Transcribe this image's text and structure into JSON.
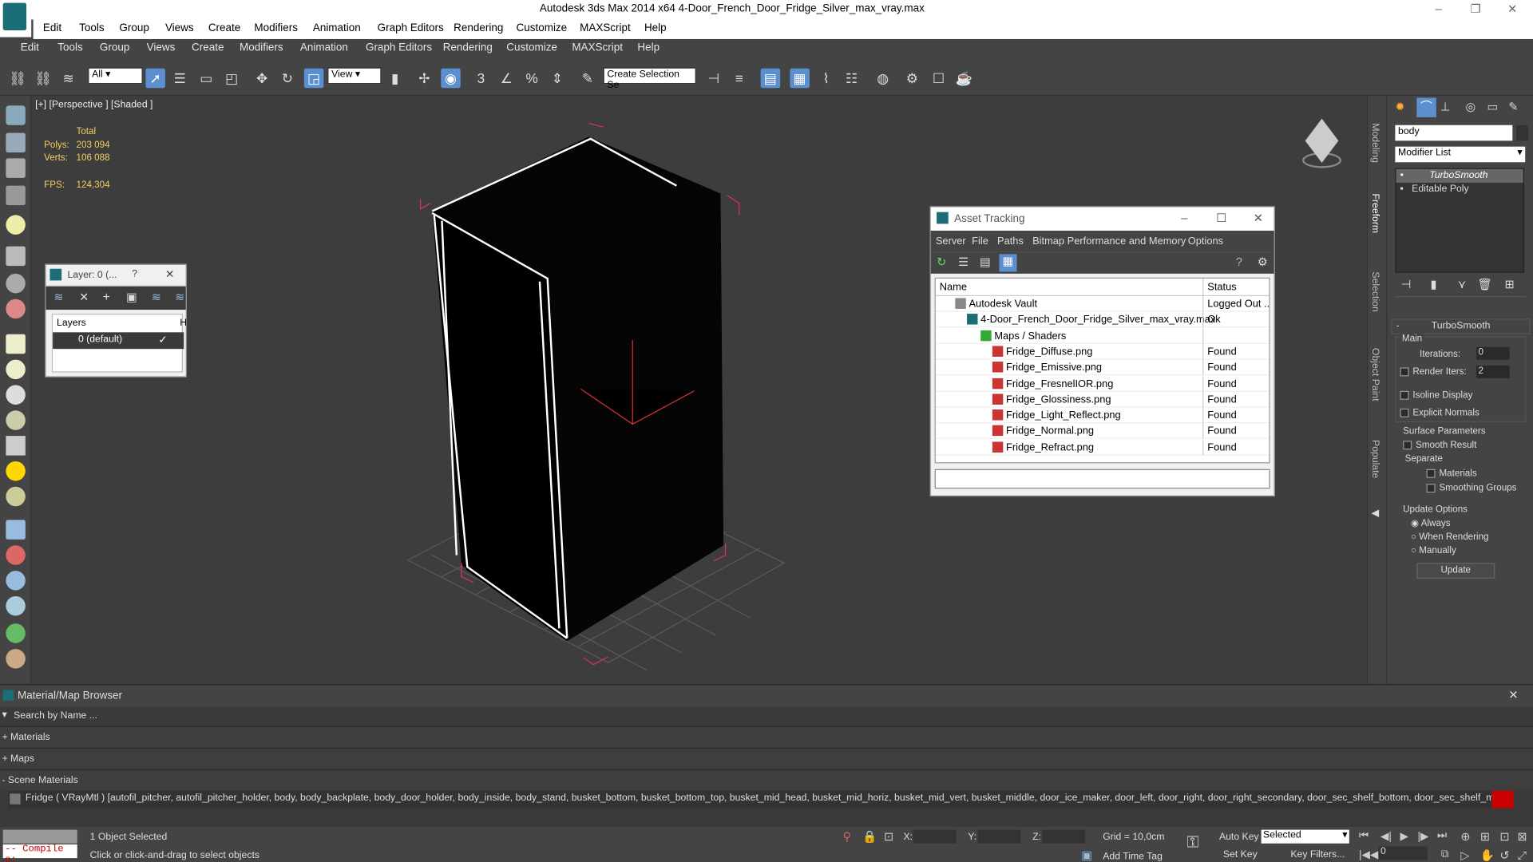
{
  "window": {
    "title": "Autodesk 3ds Max  2014 x64     4-Door_French_Door_Fridge_Silver_max_vray.max",
    "controls": [
      "–",
      "❐",
      "✕"
    ]
  },
  "menu_top": [
    "Edit",
    "Tools",
    "Group",
    "Views",
    "Create",
    "Modifiers",
    "Animation",
    "Graph Editors",
    "Rendering",
    "Customize",
    "MAXScript",
    "Help"
  ],
  "menu_main": [
    "Edit",
    "Tools",
    "Group",
    "Views",
    "Create",
    "Modifiers",
    "Animation",
    "Graph Editors",
    "Rendering",
    "Customize",
    "MAXScript",
    "Help"
  ],
  "toolbar": {
    "filter": "All",
    "refcoord": "View",
    "selset": "Create Selection Se",
    "snap_labels": [
      "3",
      "%"
    ]
  },
  "viewport": {
    "label": "[+] [Perspective ] [Shaded ]",
    "stats_header": "Total",
    "polys_label": "Polys:",
    "polys": "203 094",
    "verts_label": "Verts:",
    "verts": "106 088",
    "fps_label": "FPS:",
    "fps": "124,304"
  },
  "right_tabs": [
    "Modeling",
    "Freeform",
    "Selection",
    "Object Paint",
    "Populate"
  ],
  "layer_window": {
    "title": "Layer: 0 (...",
    "help": "?",
    "col_layers": "Layers",
    "col_h": "H",
    "row": "0 (default)"
  },
  "asset_window": {
    "title": "Asset Tracking",
    "menu": [
      "Server",
      "File",
      "Paths",
      "Bitmap Performance and Memory",
      "Options"
    ],
    "col_name": "Name",
    "col_status": "Status",
    "rows": [
      {
        "name": "Autodesk Vault",
        "status": "Logged Out ..."
      },
      {
        "name": "4-Door_French_Door_Fridge_Silver_max_vray.max",
        "status": "Ok"
      },
      {
        "name": "Maps / Shaders",
        "status": ""
      },
      {
        "name": "Fridge_Diffuse.png",
        "status": "Found"
      },
      {
        "name": "Fridge_Emissive.png",
        "status": "Found"
      },
      {
        "name": "Fridge_FresnelIOR.png",
        "status": "Found"
      },
      {
        "name": "Fridge_Glossiness.png",
        "status": "Found"
      },
      {
        "name": "Fridge_Light_Reflect.png",
        "status": "Found"
      },
      {
        "name": "Fridge_Normal.png",
        "status": "Found"
      },
      {
        "name": "Fridge_Refract.png",
        "status": "Found"
      }
    ]
  },
  "cmd_panel": {
    "object_name": "body",
    "modifier_list": "Modifier List",
    "stack": [
      "TurboSmooth",
      "Editable Poly"
    ],
    "rollout": "TurboSmooth",
    "main": "Main",
    "iterations_label": "Iterations:",
    "iterations": "0",
    "render_iters_label": "Render Iters:",
    "render_iters": "2",
    "isoline": "Isoline Display",
    "explicit": "Explicit Normals",
    "surface": "Surface Parameters",
    "smooth": "Smooth Result",
    "separate": "Separate",
    "materials": "Materials",
    "smoothing": "Smoothing Groups",
    "update_opts": "Update Options",
    "always": "Always",
    "when_rendering": "When Rendering",
    "manually": "Manually",
    "update_btn": "Update"
  },
  "material_browser": {
    "title": "Material/Map Browser",
    "search": "Search by Name ...",
    "materials": "+ Materials",
    "maps": "+ Maps",
    "scene": "- Scene Materials",
    "item": "Fridge ( VRayMtl ) [autofil_pitcher, autofil_pitcher_holder, body, body_backplate, body_door_holder, body_inside, body_stand, busket_bottom, busket_bottom_top, busket_mid_head, busket_mid_horiz, busket_mid_vert, busket_middle, door_ice_maker, door_left, door_right, door_right_secondary, door_sec_shelf_bottom, door_sec_shelf_mid, door_sec_shelf_top, do..."
  },
  "status": {
    "compile": "-- Compile e:",
    "selected": "1 Object Selected",
    "prompt": "Click or click-and-drag to select objects",
    "x": "X:",
    "y": "Y:",
    "z": "Z:",
    "grid": "Grid = 10,0cm",
    "add_tag": "Add Time Tag",
    "autokey": "Auto Key",
    "setkey": "Set Key",
    "selected_dd": "Selected",
    "key_filters": "Key Filters...",
    "frame": "0"
  }
}
